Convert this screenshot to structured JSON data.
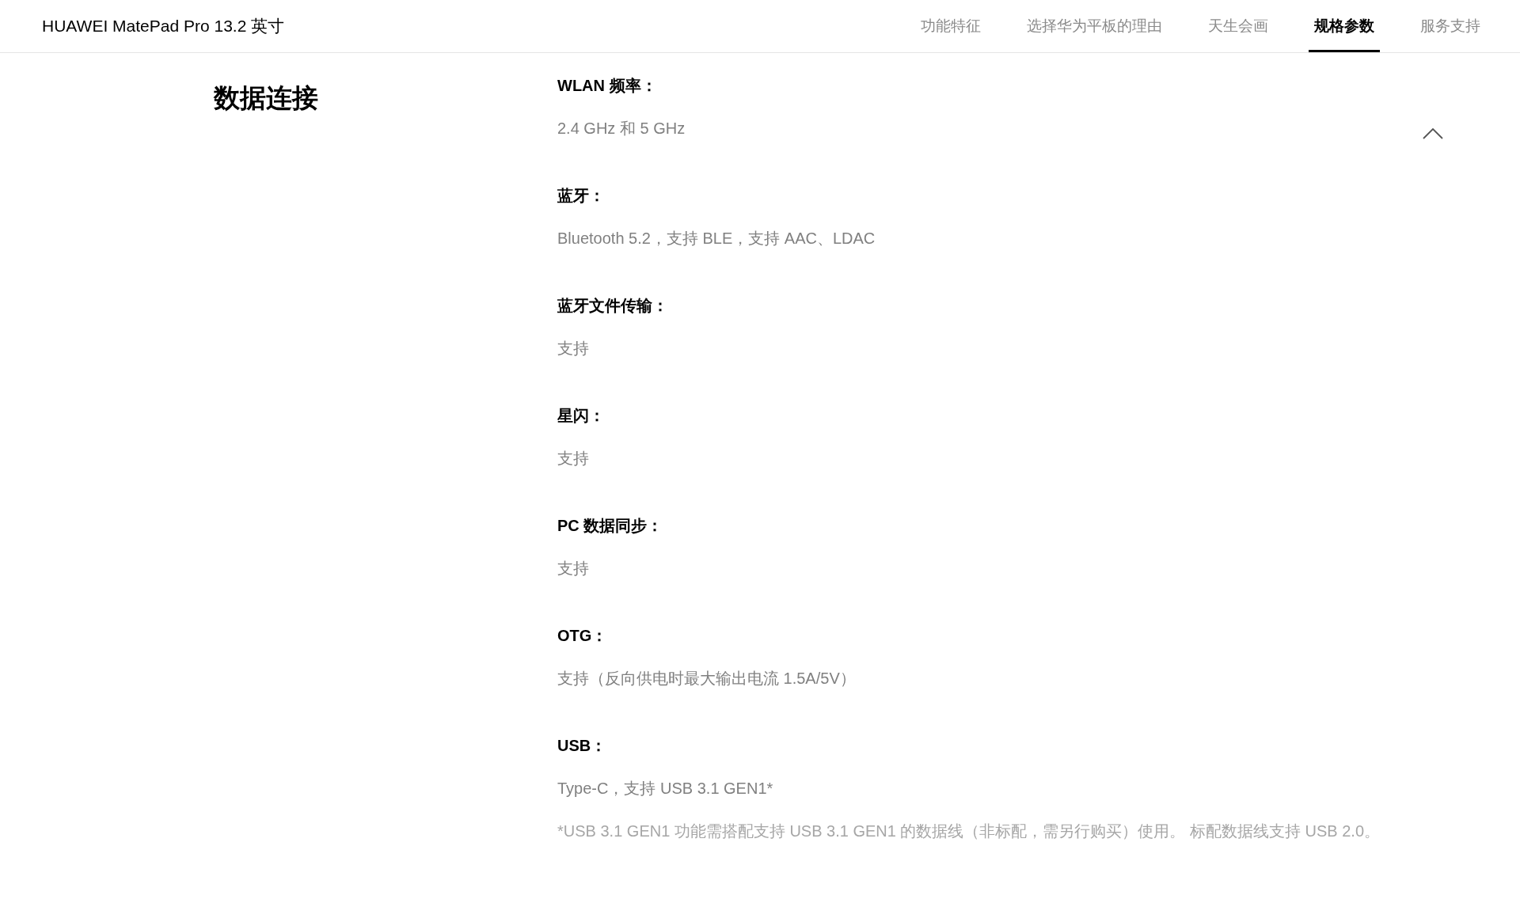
{
  "header": {
    "title": "HUAWEI MatePad Pro 13.2 英寸",
    "tabs": [
      {
        "label": "功能特征",
        "selected": false
      },
      {
        "label": "选择华为平板的理由",
        "selected": false
      },
      {
        "label": "天生会画",
        "selected": false
      },
      {
        "label": "规格参数",
        "selected": true
      },
      {
        "label": "服务支持",
        "selected": false
      }
    ]
  },
  "section": {
    "title": "数据连接",
    "expanded": true,
    "specs": [
      {
        "label": "WLAN 频率：",
        "value": "2.4 GHz 和 5 GHz"
      },
      {
        "label": "蓝牙：",
        "value": "Bluetooth 5.2，支持 BLE，支持 AAC、LDAC"
      },
      {
        "label": "蓝牙文件传输：",
        "value": "支持"
      },
      {
        "label": "星闪：",
        "value": "支持"
      },
      {
        "label": "PC 数据同步：",
        "value": "支持"
      },
      {
        "label": "OTG：",
        "value": "支持（反向供电时最大输出电流 1.5A/5V）"
      },
      {
        "label": "USB：",
        "value": "Type-C，支持 USB 3.1 GEN1*",
        "note": "*USB 3.1 GEN1 功能需搭配支持 USB 3.1 GEN1 的数据线（非标配，需另行购买）使用。 标配数据线支持 USB 2.0。"
      }
    ]
  }
}
